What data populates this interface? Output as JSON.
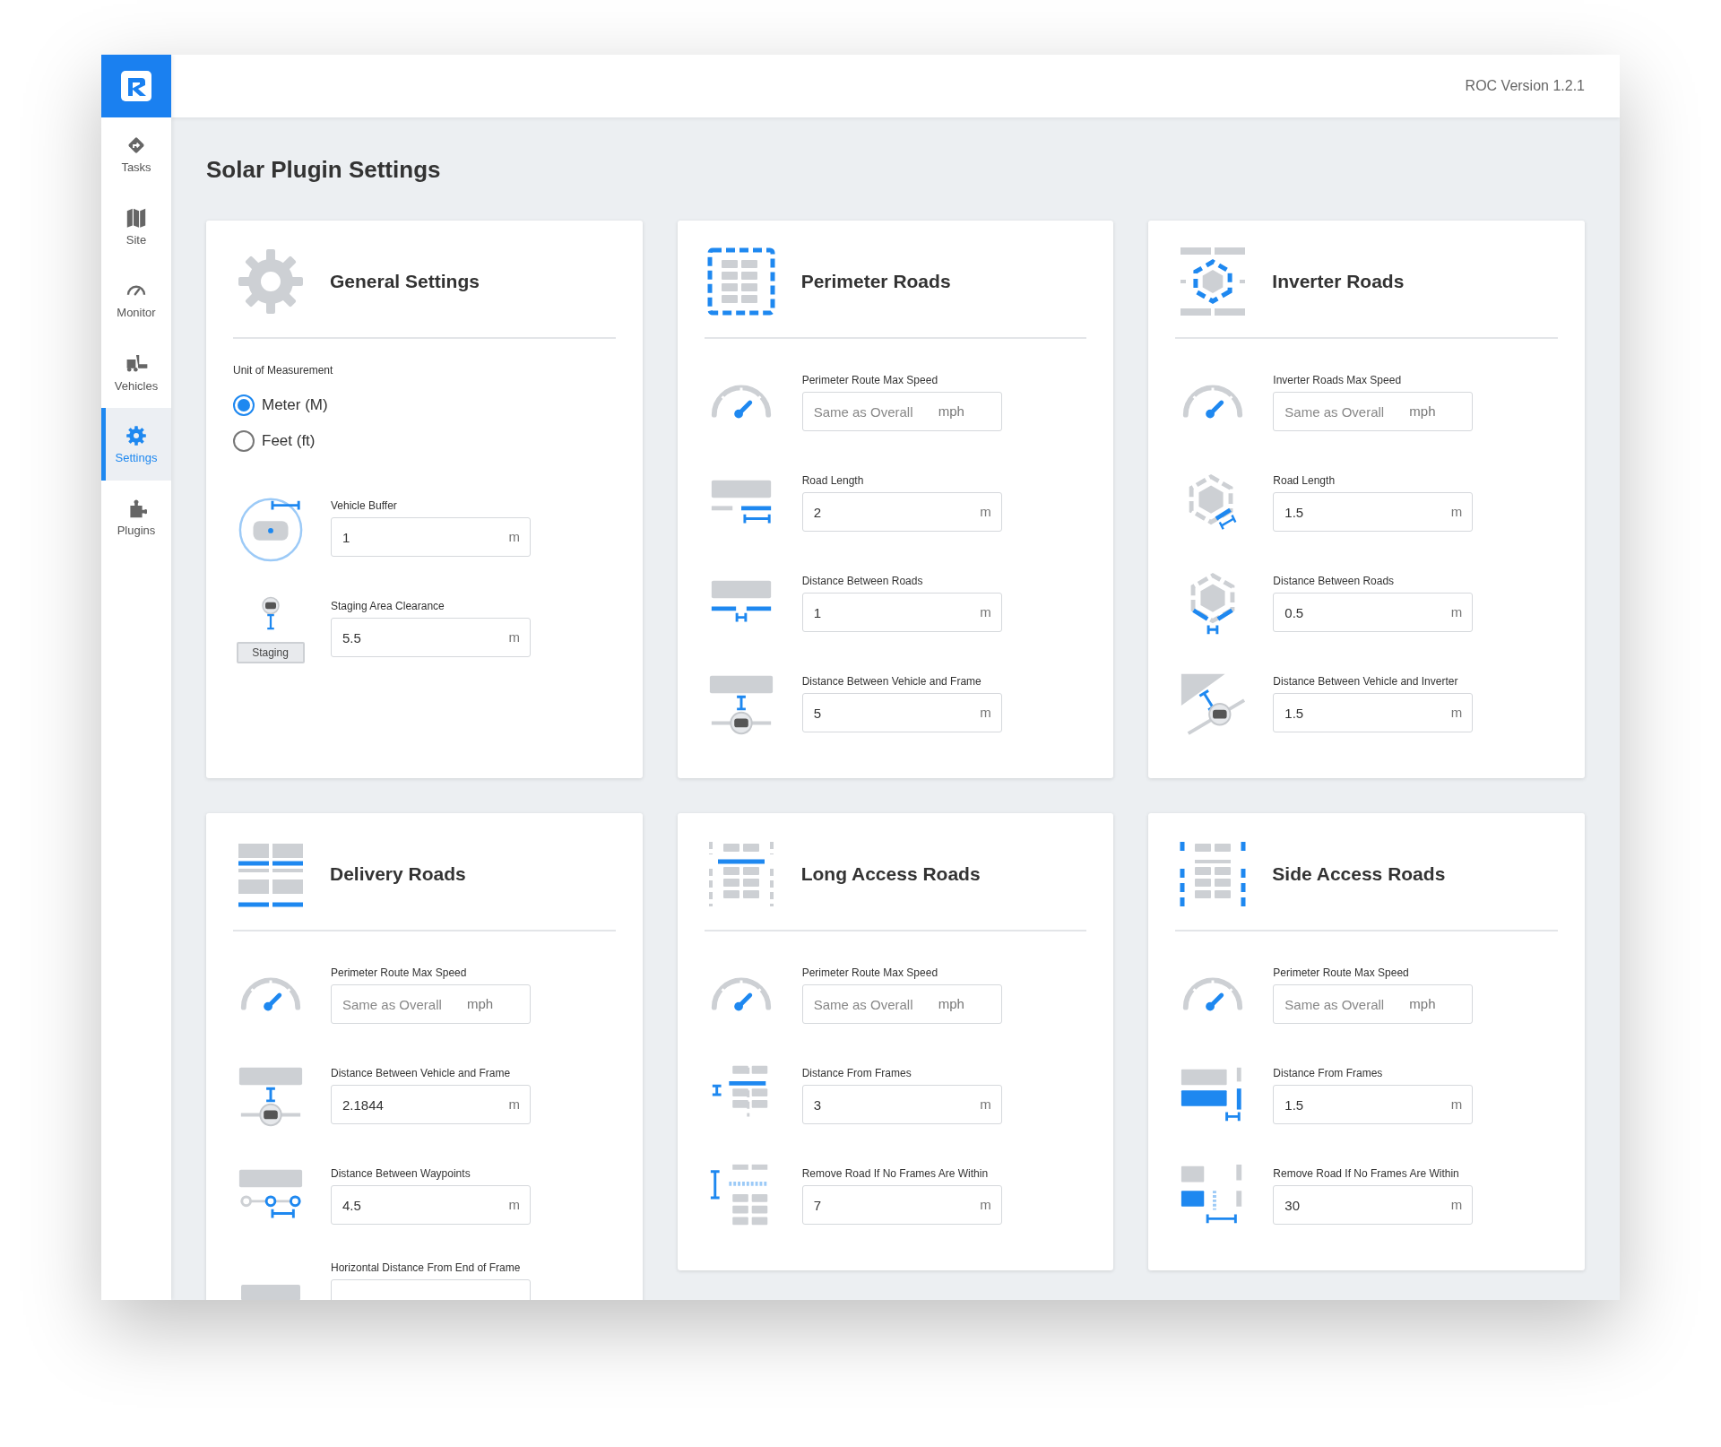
{
  "app": {
    "version": "ROC Version 1.2.1"
  },
  "sidebar": {
    "items": [
      {
        "label": "Tasks",
        "selected": false
      },
      {
        "label": "Site",
        "selected": false
      },
      {
        "label": "Monitor",
        "selected": false
      },
      {
        "label": "Vehicles",
        "selected": false
      },
      {
        "label": "Settings",
        "selected": true
      },
      {
        "label": "Plugins",
        "selected": false
      }
    ]
  },
  "page_title": "Solar Plugin Settings",
  "cards": [
    {
      "kind": "general",
      "title": "General Settings",
      "unit_of_measurement": {
        "label": "Unit of Measurement",
        "options": [
          {
            "label": "Meter (M)",
            "selected": true
          },
          {
            "label": "Feet (ft)",
            "selected": false
          }
        ]
      },
      "fields": [
        {
          "kind": "buffer",
          "label": "Vehicle Buffer",
          "value": "1",
          "unit": "m"
        },
        {
          "kind": "staging",
          "icon_label": "Staging",
          "label": "Staging Area Clearance",
          "value": "5.5",
          "unit": "m"
        }
      ]
    },
    {
      "kind": "perimeter",
      "title": "Perimeter Roads",
      "fields": [
        {
          "kind": "speed",
          "label": "Perimeter Route Max Speed",
          "placeholder": "Same as Overall",
          "unit": "mph"
        },
        {
          "kind": "road-length",
          "label": "Road Length",
          "value": "2",
          "unit": "m"
        },
        {
          "kind": "road-distance",
          "label": "Distance Between Roads",
          "value": "1",
          "unit": "m"
        },
        {
          "kind": "vehicle-frame",
          "label": "Distance Between Vehicle and Frame",
          "value": "5",
          "unit": "m"
        }
      ]
    },
    {
      "kind": "inverter",
      "title": "Inverter Roads",
      "fields": [
        {
          "kind": "speed",
          "label": "Inverter Roads Max Speed",
          "placeholder": "Same as Overall",
          "unit": "mph"
        },
        {
          "kind": "hex-length",
          "label": "Road Length",
          "value": "1.5",
          "unit": "m"
        },
        {
          "kind": "hex-distance",
          "label": "Distance Between Roads",
          "value": "0.5",
          "unit": "m"
        },
        {
          "kind": "vehicle-inverter",
          "label": "Distance Between Vehicle and Inverter",
          "value": "1.5",
          "unit": "m"
        }
      ]
    },
    {
      "kind": "delivery",
      "title": "Delivery Roads",
      "fields": [
        {
          "kind": "speed",
          "label": "Perimeter Route Max Speed",
          "placeholder": "Same as Overall",
          "unit": "mph"
        },
        {
          "kind": "vehicle-frame",
          "label": "Distance Between Vehicle and Frame",
          "value": "2.1844",
          "unit": "m"
        },
        {
          "kind": "waypoints",
          "label": "Distance Between Waypoints",
          "value": "4.5",
          "unit": "m"
        },
        {
          "kind": "frame-end",
          "label": "Horizontal Distance From End of Frame"
        }
      ]
    },
    {
      "kind": "long-access",
      "title": "Long Access Roads",
      "fields": [
        {
          "kind": "speed",
          "label": "Perimeter Route Max Speed",
          "placeholder": "Same as Overall",
          "unit": "mph"
        },
        {
          "kind": "long-frames",
          "label": "Distance From Frames",
          "value": "3",
          "unit": "m"
        },
        {
          "kind": "long-remove",
          "label": "Remove Road If No Frames Are Within",
          "value": "7",
          "unit": "m"
        }
      ]
    },
    {
      "kind": "side-access",
      "title": "Side Access Roads",
      "fields": [
        {
          "kind": "speed",
          "label": "Perimeter Route Max Speed",
          "placeholder": "Same as Overall",
          "unit": "mph"
        },
        {
          "kind": "side-frames",
          "label": "Distance From Frames",
          "value": "1.5",
          "unit": "m"
        },
        {
          "kind": "side-remove",
          "label": "Remove Road If No Frames Are Within",
          "value": "30",
          "unit": "m"
        }
      ]
    }
  ]
}
